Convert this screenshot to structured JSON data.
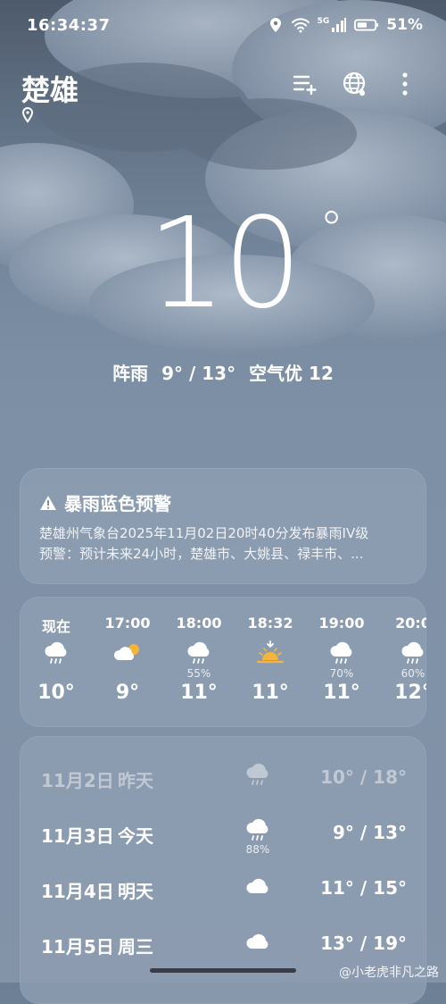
{
  "status_bar": {
    "time": "16:34:37",
    "network": "5G",
    "battery": "51%"
  },
  "header": {
    "city": "楚雄",
    "icons": [
      "location-pin-icon",
      "add-city-icon",
      "globe-icon",
      "more-vertical-icon"
    ]
  },
  "current": {
    "temperature": "10",
    "degree_symbol": "°",
    "condition": "阵雨",
    "range": "9° / 13°",
    "air_quality": "空气优 12"
  },
  "alert": {
    "title": "暴雨蓝色预警",
    "line1": "楚雄州气象台2025年11月02日20时40分发布暴雨IV级",
    "line2": "预警：预计未来24小时，楚雄市、大姚县、禄丰市、..."
  },
  "hourly": [
    {
      "time": "现在",
      "icon": "rain-cloud-icon",
      "pct": "",
      "temp": "10°"
    },
    {
      "time": "17:00",
      "icon": "partly-cloudy-icon",
      "pct": "",
      "temp": "9°"
    },
    {
      "time": "18:00",
      "icon": "rain-cloud-icon",
      "pct": "55%",
      "temp": "11°"
    },
    {
      "time": "18:32",
      "icon": "sunset-icon",
      "pct": "",
      "temp": "11°"
    },
    {
      "time": "19:00",
      "icon": "rain-cloud-icon",
      "pct": "70%",
      "temp": "11°"
    },
    {
      "time": "20:0",
      "icon": "rain-cloud-icon",
      "pct": "60%",
      "temp": "12°"
    }
  ],
  "daily": [
    {
      "date": "11月2日",
      "rel": "昨天",
      "icon": "rain-cloud-icon",
      "pct": "",
      "range": "10° / 18°"
    },
    {
      "date": "11月3日",
      "rel": "今天",
      "icon": "rain-cloud-icon",
      "pct": "88%",
      "range": "9° / 13°"
    },
    {
      "date": "11月4日",
      "rel": "明天",
      "icon": "cloud-icon",
      "pct": "",
      "range": "11° / 15°"
    },
    {
      "date": "11月5日",
      "rel": "周三",
      "icon": "cloud-icon",
      "pct": "",
      "range": "13° / 19°"
    }
  ],
  "watermark": "@小老虎非凡之路",
  "colors": {
    "sun": "#f4b53a",
    "card": "#8e9db2",
    "sky_top": "#6d7f95"
  }
}
